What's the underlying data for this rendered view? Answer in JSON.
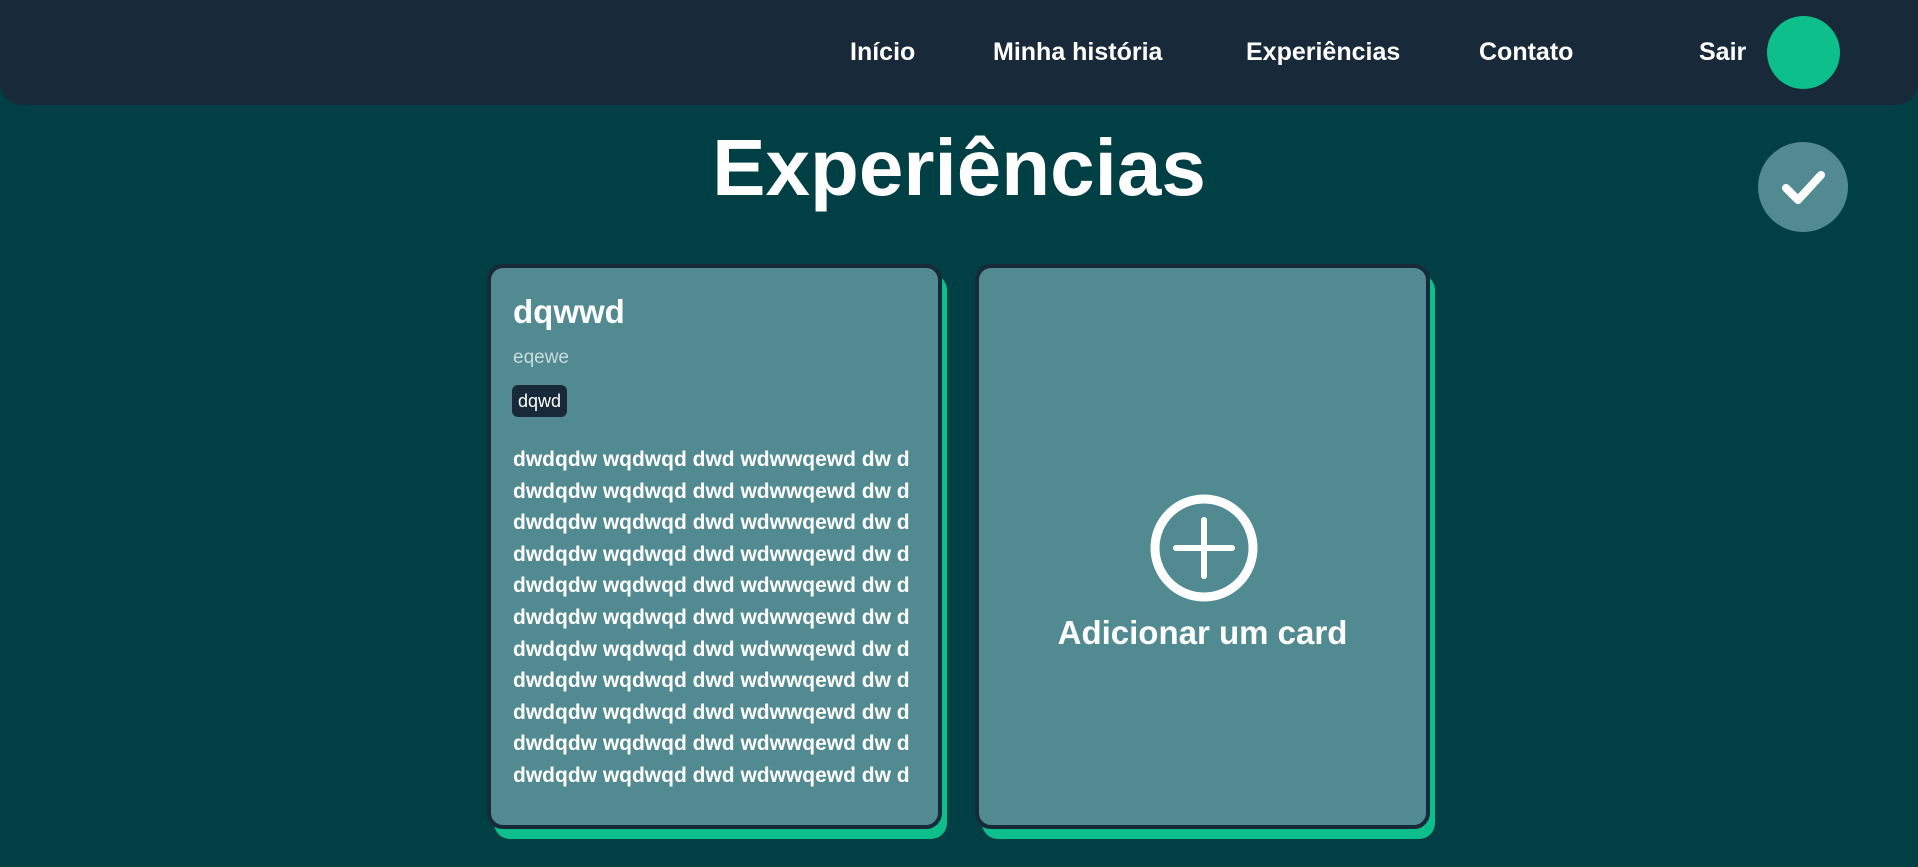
{
  "nav": {
    "items": [
      {
        "label": "Início"
      },
      {
        "label": "Minha história"
      },
      {
        "label": "Experiências"
      },
      {
        "label": "Contato"
      }
    ],
    "logout_label": "Sair"
  },
  "page": {
    "title": "Experiências"
  },
  "cards": [
    {
      "title": "dqwwd",
      "subtitle": "eqewe",
      "tag": "dqwd",
      "body_lines": [
        "dwdqdw wqdwqd dwd wdwwqewd dw d",
        "dwdqdw wqdwqd dwd wdwwqewd dw d",
        "dwdqdw wqdwqd dwd wdwwqewd dw d",
        "dwdqdw wqdwqd dwd wdwwqewd dw d",
        "dwdqdw wqdwqd dwd wdwwqewd dw d",
        "dwdqdw wqdwqd dwd wdwwqewd dw d",
        "dwdqdw wqdwqd dwd wdwwqewd dw d",
        "dwdqdw wqdwqd dwd wdwwqewd dw d",
        "dwdqdw wqdwqd dwd wdwwqewd dw d",
        "dwdqdw wqdwqd dwd wdwwqewd dw d",
        "dwdqdw wqdwqd dwd wdwwqewd dw d"
      ]
    }
  ],
  "add_card": {
    "label": "Adicionar um card",
    "icon": "plus-circle-icon"
  },
  "icons": {
    "confirm": "check-icon"
  },
  "colors": {
    "background": "#003f44",
    "header": "#18293a",
    "accent": "#0dbf8a",
    "card": "#528a92"
  }
}
